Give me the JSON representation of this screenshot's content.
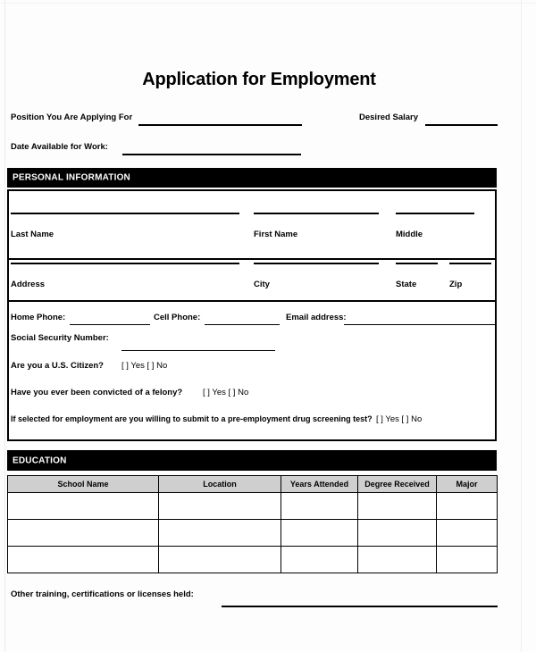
{
  "document": {
    "title": "Application for Employment"
  },
  "top_fields": {
    "position_label": "Position You Are Applying For",
    "desired_salary_label": "Desired Salary",
    "date_available_label": "Date Available for Work:"
  },
  "personal_information": {
    "section_title": "PERSONAL INFORMATION",
    "name_row": {
      "last_name_label": "Last Name",
      "first_name_label": "First Name",
      "middle_label": "Middle"
    },
    "address_row": {
      "address_label": "Address",
      "city_label": "City",
      "state_label": "State",
      "zip_label": "Zip"
    },
    "contact_row": {
      "home_phone_label": "Home Phone:",
      "cell_phone_label": "Cell Phone:",
      "email_label": "Email address:"
    },
    "ssn_label": "Social Security Number:",
    "questions": [
      {
        "text": "Are you a U.S. Citizen?",
        "options": "[ ] Yes [ ] No"
      },
      {
        "text": "Have you ever been convicted of a felony?",
        "options": "[ ] Yes [ ] No"
      },
      {
        "text": "If selected for employment are you willing to submit to a pre-employment drug screening test?",
        "options": "[ ] Yes [ ] No"
      }
    ]
  },
  "education": {
    "section_title": "EDUCATION",
    "columns": [
      "School Name",
      "Location",
      "Years Attended",
      "Degree Received",
      "Major"
    ],
    "rows": [
      [
        "",
        "",
        "",
        "",
        ""
      ],
      [
        "",
        "",
        "",
        "",
        ""
      ],
      [
        "",
        "",
        "",
        "",
        ""
      ]
    ],
    "other_training_label": "Other training, certifications or licenses held:"
  },
  "colors": {
    "page_background": "#fdfdfd",
    "section_bar": "#000000",
    "section_bar_text": "#ffffff",
    "table_header_fill": "#cfcfcf",
    "rule": "#000000"
  }
}
